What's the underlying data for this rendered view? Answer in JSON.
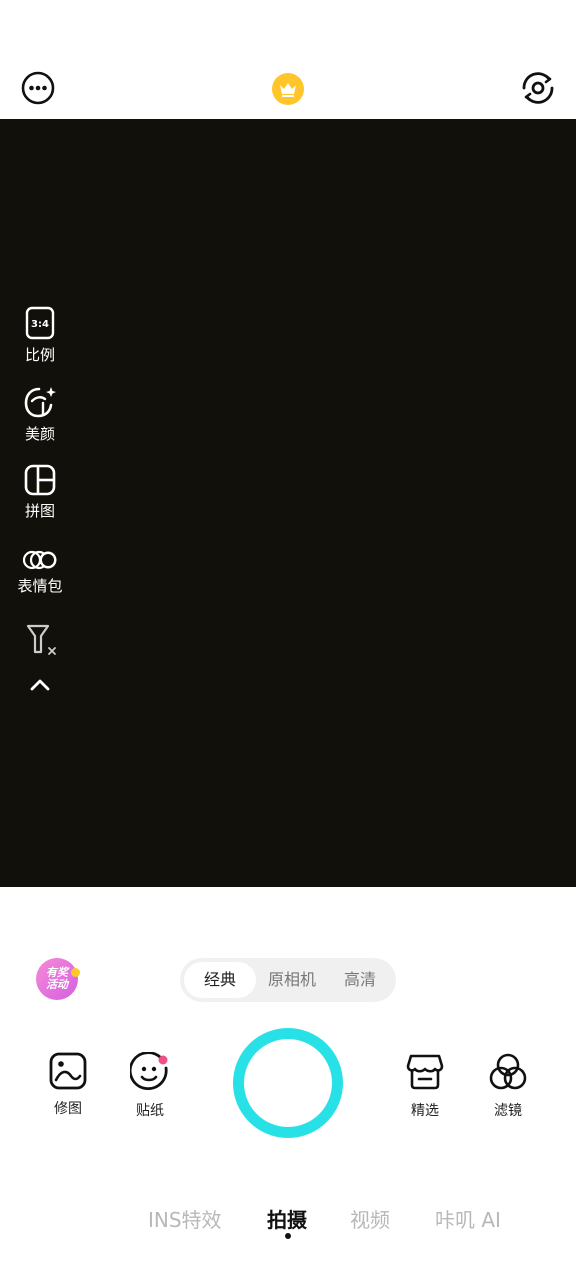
{
  "top_bar": {
    "more_icon": "more-horizontal-icon",
    "vip_icon": "crown-icon",
    "flip_icon": "camera-flip-icon"
  },
  "side_tools": [
    {
      "label": "比例",
      "icon": "aspect-ratio-icon",
      "ratio_text": "3:4"
    },
    {
      "label": "美颜",
      "icon": "beauty-face-icon"
    },
    {
      "label": "拼图",
      "icon": "collage-icon"
    },
    {
      "label": "表情包",
      "icon": "meme-pack-icon"
    }
  ],
  "side_extra": {
    "filter_off_icon": "filter-off-icon",
    "collapse_icon": "chevron-up-icon"
  },
  "promo": {
    "text_line1": "有奖",
    "text_line2": "活动"
  },
  "capture_modes": [
    {
      "label": "经典",
      "active": true
    },
    {
      "label": "原相机",
      "active": false
    },
    {
      "label": "高清",
      "active": false
    }
  ],
  "bottom_tools": {
    "edit": {
      "label": "修图",
      "icon": "image-edit-icon"
    },
    "sticker": {
      "label": "贴纸",
      "icon": "sticker-smile-icon"
    },
    "featured": {
      "label": "精选",
      "icon": "store-icon"
    },
    "filter": {
      "label": "滤镜",
      "icon": "filter-circles-icon"
    }
  },
  "tabs": [
    {
      "label": "INS特效",
      "active": false
    },
    {
      "label": "拍摄",
      "active": true
    },
    {
      "label": "视频",
      "active": false
    },
    {
      "label": "咔叽 AI",
      "active": false
    }
  ],
  "colors": {
    "shutter_ring": "#28e1e6",
    "crown_bg": "#ffc52b",
    "viewfinder": "#12100b"
  }
}
